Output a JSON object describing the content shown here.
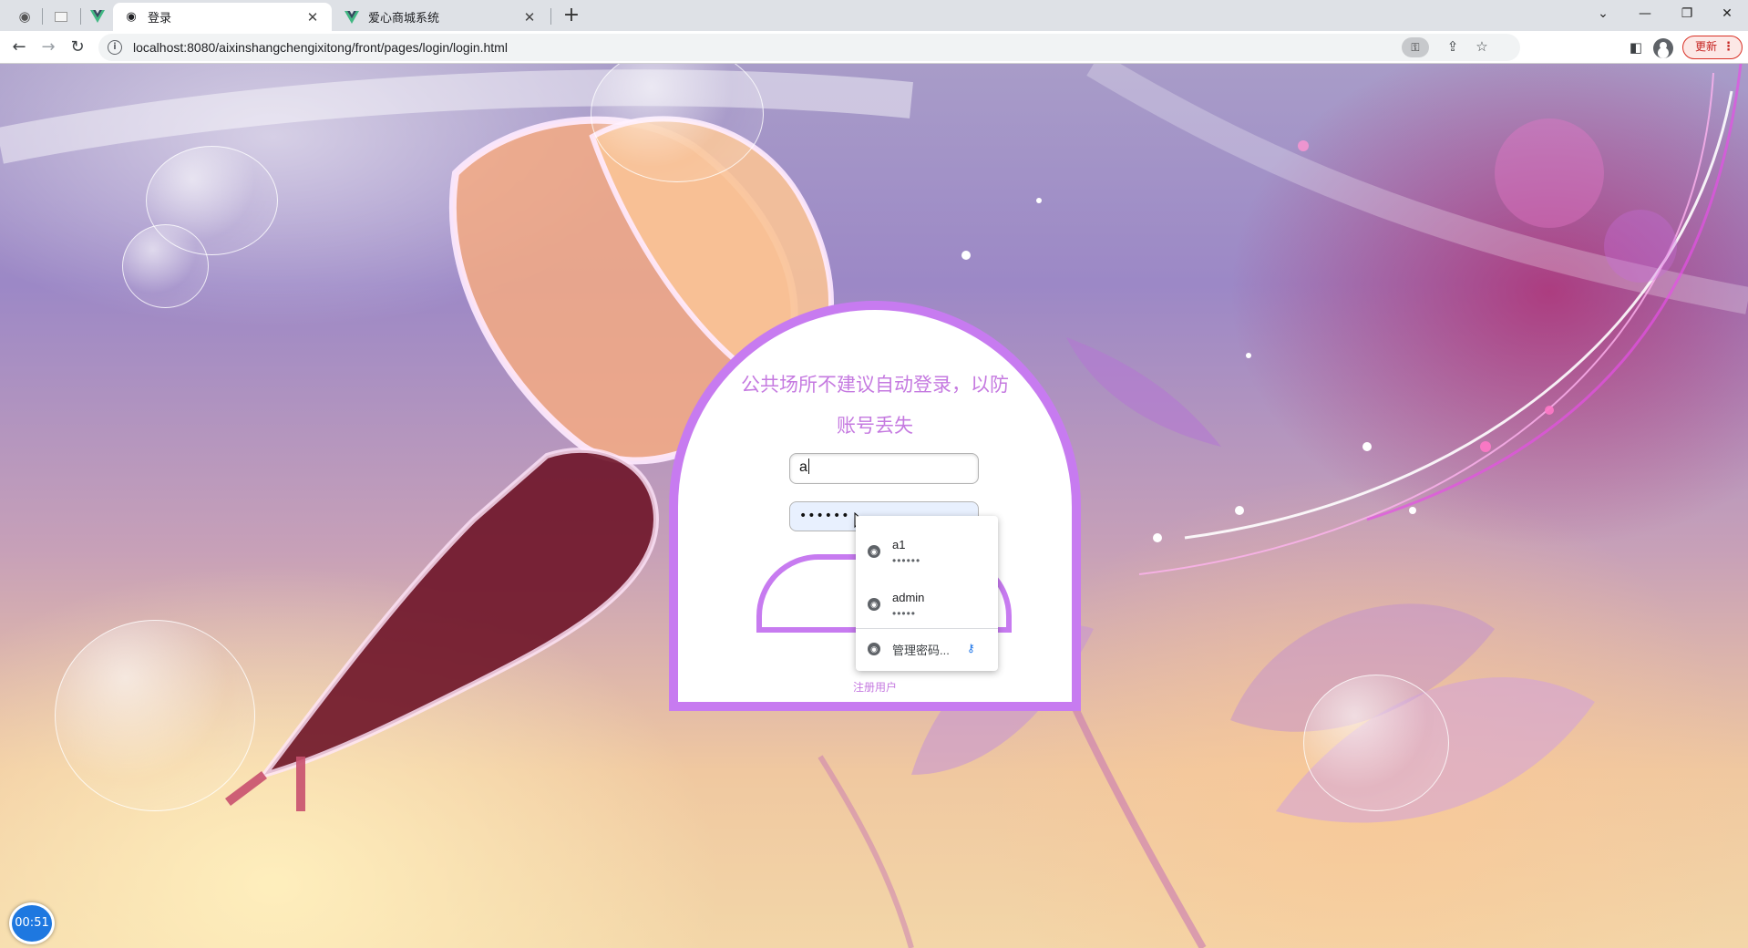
{
  "tabs": [
    {
      "title": "登录",
      "active": true,
      "icon": "globe-icon"
    },
    {
      "title": "爱心商城系统",
      "active": false,
      "icon": "vue-logo-icon"
    }
  ],
  "toolbar": {
    "url": "localhost:8080/aixinshangchengixitong/front/pages/login/login.html",
    "update_label": "更新"
  },
  "login": {
    "title": "公共场所不建议自动登录，以防账号丢失",
    "username_value": "a",
    "password_value": "••••••",
    "register_label": "注册用户"
  },
  "autofill": {
    "items": [
      {
        "username": "a1",
        "password": "••••••"
      },
      {
        "username": "admin",
        "password": "•••••"
      }
    ],
    "manage_label": "管理密码..."
  },
  "timer": "00:51",
  "colors": {
    "accent": "#c77bf0",
    "title_text": "#c57ae0",
    "update_red": "#d93025"
  }
}
